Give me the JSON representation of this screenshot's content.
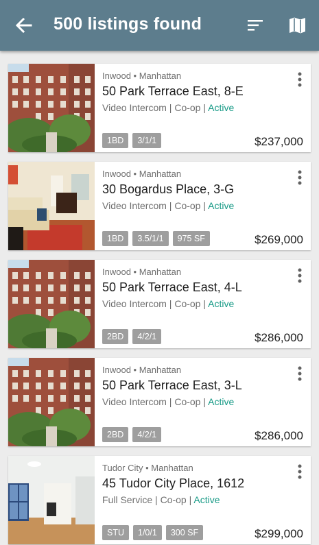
{
  "header": {
    "title": "500 listings found",
    "back_icon": "arrow-left",
    "sort_icon": "sort-lines",
    "map_icon": "map"
  },
  "colors": {
    "appbar": "#5d7d8d",
    "status_active": "#179a86",
    "tag_bg": "#9e9e9e"
  },
  "listings": [
    {
      "area": "Inwood • Manhattan",
      "address": "50 Park Terrace East, 8-E",
      "amenity": "Video Intercom",
      "type": "Co-op",
      "status": "Active",
      "tags": [
        "1BD",
        "3/1/1"
      ],
      "price": "$237,000",
      "photo": "brick-building"
    },
    {
      "area": "Inwood • Manhattan",
      "address": "30 Bogardus Place, 3-G",
      "amenity": "Video Intercom",
      "type": "Co-op",
      "status": "Active",
      "tags": [
        "1BD",
        "3.5/1/1",
        "975 SF"
      ],
      "price": "$269,000",
      "photo": "living-room"
    },
    {
      "area": "Inwood • Manhattan",
      "address": "50 Park Terrace East, 4-L",
      "amenity": "Video Intercom",
      "type": "Co-op",
      "status": "Active",
      "tags": [
        "2BD",
        "4/2/1"
      ],
      "price": "$286,000",
      "photo": "brick-building"
    },
    {
      "area": "Inwood • Manhattan",
      "address": "50 Park Terrace East, 3-L",
      "amenity": "Video Intercom",
      "type": "Co-op",
      "status": "Active",
      "tags": [
        "2BD",
        "4/2/1"
      ],
      "price": "$286,000",
      "photo": "brick-building"
    },
    {
      "area": "Tudor City • Manhattan",
      "address": "45 Tudor City Place, 1612",
      "amenity": "Full Service",
      "type": "Co-op",
      "status": "Active",
      "tags": [
        "STU",
        "1/0/1",
        "300 SF"
      ],
      "price": "$299,000",
      "photo": "studio-interior"
    }
  ]
}
